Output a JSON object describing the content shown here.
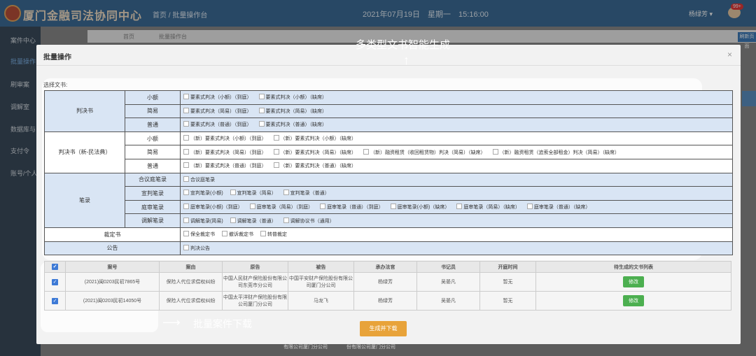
{
  "app": {
    "brand": "厦门金融司法协同中心",
    "breadcrumb": "首页 / 批量操作台",
    "datetime": "2021年07月19日 星期一 15:16:00",
    "user": "杨绿芳 ▾",
    "badge": "99+"
  },
  "sidebar": {
    "items": [
      "案件中心",
      "批量操作",
      "刷审案",
      "调解室",
      "数据库与",
      "支付令",
      "账号/个人"
    ]
  },
  "tabs": {
    "t1": "首页",
    "t2": "批量操作台",
    "right_btn": "刷新页面"
  },
  "modal": {
    "title": "批量操作",
    "close": "×",
    "select_label": "选择文书:",
    "generate_button": "生成并下载"
  },
  "doc_table": {
    "judgment": {
      "label": "判决书",
      "rows": [
        {
          "sub": "小额",
          "opts": [
            "要素式判决（小额）（到庭）",
            "要素式判决（小额）（缺席）"
          ]
        },
        {
          "sub": "简易",
          "opts": [
            "要素式判决（简易）（到庭）",
            "要素式判决（简易）（缺席）"
          ]
        },
        {
          "sub": "普通",
          "opts": [
            "要素式判决（普通）（到庭）",
            "要素式判决（普通）（缺席）"
          ]
        }
      ]
    },
    "judgment_new": {
      "label": "判决书（新-民法典）",
      "rows": [
        {
          "sub": "小额",
          "opts": [
            "（新）要素式判决（小额）（到庭）",
            "（新）要素式判决（小额）（缺席）"
          ]
        },
        {
          "sub": "简易",
          "opts": [
            "（新）要素式判决（简易）（到庭）",
            "（新）要素式判决（简易）（缺席）",
            "（新）融资租赁（收回租赁物）判决（简易）（缺席）",
            "（新）融资租赁（追索全部租金）判决（简易）（缺席）"
          ]
        },
        {
          "sub": "普通",
          "opts": [
            "（新）要素式判决（普通）（到庭）",
            "（新）要素式判决（普通）（缺席）"
          ]
        }
      ]
    },
    "records": {
      "label": "笔录",
      "rows": [
        {
          "sub": "合议庭笔录",
          "opts": [
            "合议庭笔录"
          ]
        },
        {
          "sub": "宣判笔录",
          "opts": [
            "宣判笔录(小额)",
            "宣判笔录（简易）",
            "宣判笔录（普通）"
          ]
        },
        {
          "sub": "庭审笔录",
          "opts": [
            "庭审笔录(小额)（到庭）",
            "庭审笔录（简易）（到庭）",
            "庭审笔录（普通）（到庭）",
            "庭审笔录(小额)（缺席）",
            "庭审笔录（简易）（缺席）",
            "庭审笔录（普通）（缺席）"
          ]
        },
        {
          "sub": "调解笔录",
          "opts": [
            "调解笔录(简易)",
            "调解笔录（普通）",
            "调解协议书（通用）"
          ]
        }
      ]
    },
    "ruling": {
      "label": "裁定书",
      "opts": [
        "保全裁定书",
        "撤诉裁定书",
        "转普裁定"
      ]
    },
    "notice": {
      "label": "公告",
      "opts": [
        "判决公告"
      ]
    }
  },
  "cases": {
    "headers": [
      "案号",
      "案由",
      "原告",
      "被告",
      "承办法官",
      "书记员",
      "开庭时间",
      "待生成的文书列表"
    ],
    "rows": [
      {
        "no": "(2021)闽0203民初7865号",
        "cause": "保险人代位求偿权纠纷",
        "plaintiff": "中国人民财产保险股份有限公司东莞市分公司",
        "defendant": "中国平安财产保险股份有限公司厦门分公司",
        "judge": "杨绿芳",
        "clerk": "吴晏凡",
        "time": "暂无",
        "action": "修改"
      },
      {
        "no": "(2021)闽0203民初14050号",
        "cause": "保险人代位求偿权纠纷",
        "plaintiff": "中国太平洋财产保险股份有限公司厦门分公司",
        "defendant": "马龙飞",
        "judge": "杨绿芳",
        "clerk": "吴晏凡",
        "time": "暂无",
        "action": "修改"
      }
    ]
  },
  "annotations": {
    "top": "多类型文书智能生成",
    "bottom": "批量案件下载",
    "arrow_up": "↑",
    "arrow_right": "⟶"
  },
  "behind": {
    "a": "有限公司厦门分公司",
    "b": "份有限公司厦门分公司"
  }
}
